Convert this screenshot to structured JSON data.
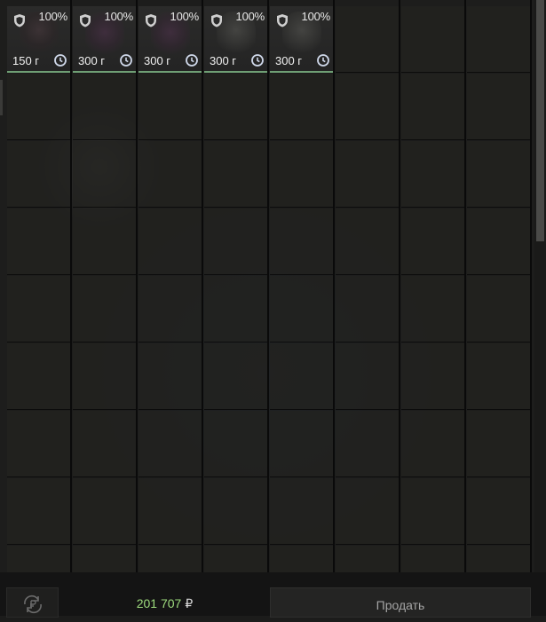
{
  "inventory": {
    "items": [
      {
        "durability": "100%",
        "weight": "150 г",
        "img": "dark"
      },
      {
        "durability": "100%",
        "weight": "300 г",
        "img": "purple"
      },
      {
        "durability": "100%",
        "weight": "300 г",
        "img": "purple"
      },
      {
        "durability": "100%",
        "weight": "300 г",
        "img": "grey"
      },
      {
        "durability": "100%",
        "weight": "300 г",
        "img": "grey"
      }
    ]
  },
  "footer": {
    "balance": "201 707",
    "currency": "₽",
    "sell_label": "Продать",
    "refresh_icon": "ruble-refresh-icon"
  },
  "colors": {
    "balance": "#9edc7e",
    "item_underline": "#6f9f74"
  }
}
